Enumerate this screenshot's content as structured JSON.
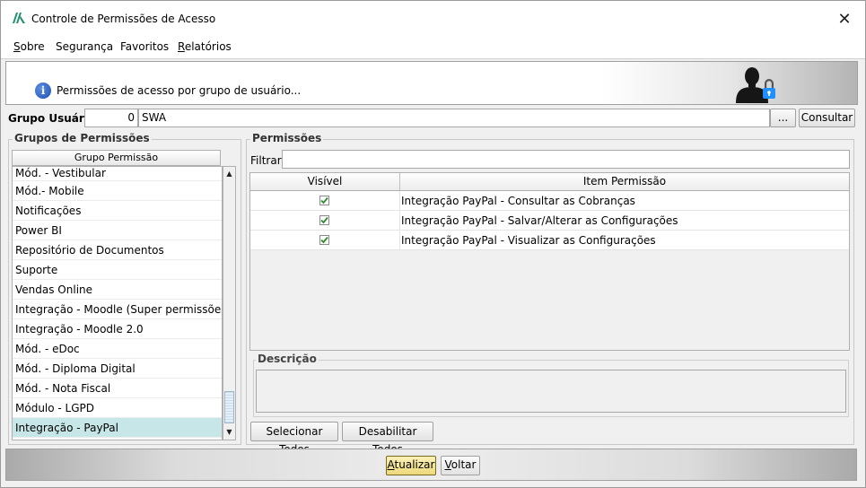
{
  "window": {
    "title": "Controle de Permissões de Acesso",
    "close_glyph": "✕"
  },
  "menu": [
    {
      "label": "Sobre",
      "u": "S",
      "rest": "obre"
    },
    {
      "label": "Segurança",
      "u": "",
      "rest": "Segurança"
    },
    {
      "label": "Favoritos",
      "u": "",
      "rest": "Favoritos"
    },
    {
      "label": "Relatórios",
      "u": "R",
      "rest": "elatórios"
    }
  ],
  "banner": {
    "text": "Permissões de acesso por grupo de usuário...",
    "info_glyph": "i",
    "icon": "user-lock-icon"
  },
  "user_group": {
    "label": "Grupo Usuário:",
    "code": "0",
    "name": "SWA",
    "browse_label": "...",
    "search_label": "Consultar"
  },
  "groups": {
    "legend": "Grupos de Permissões",
    "column_header": "Grupo Permissão",
    "items": [
      "Mód. - Vestibular",
      "Mód.- Mobile",
      "Notificações",
      "Power BI",
      "Repositório de Documentos",
      "Suporte",
      "Vendas Online",
      "Integração - Moodle (Super permissões)",
      "Integração - Moodle 2.0",
      "Mód. - eDoc",
      "Mód. - Diploma Digital",
      "Mód. - Nota Fiscal",
      "Módulo - LGPD",
      "Integração - PayPal"
    ],
    "selected": "Integração - PayPal"
  },
  "permissions": {
    "legend": "Permissões",
    "filter_label": "Filtrar:",
    "filter_value": "",
    "columns": [
      "Visível",
      "Item Permissão"
    ],
    "rows": [
      {
        "visible": true,
        "item": "Integração PayPal - Consultar as Cobranças"
      },
      {
        "visible": true,
        "item": "Integração PayPal - Salvar/Alterar as Configurações"
      },
      {
        "visible": true,
        "item": "Integração PayPal - Visualizar as Configurações"
      }
    ],
    "description_label": "Descrição",
    "select_all_label": "Selecionar Todos",
    "disable_all_label": "Desabilitar Todos"
  },
  "footer": {
    "update_label": "Atualizar",
    "update_u": "A",
    "update_rest": "tualizar",
    "back_label": "Voltar",
    "back_u": "V",
    "back_rest": "oltar"
  },
  "colors": {
    "selected_row": "#c6e6e8",
    "check_green": "#2e8b2e",
    "info_blue": "#1f4fb0",
    "lock_blue": "#1e90ff",
    "update_button": "#f2e49a"
  }
}
